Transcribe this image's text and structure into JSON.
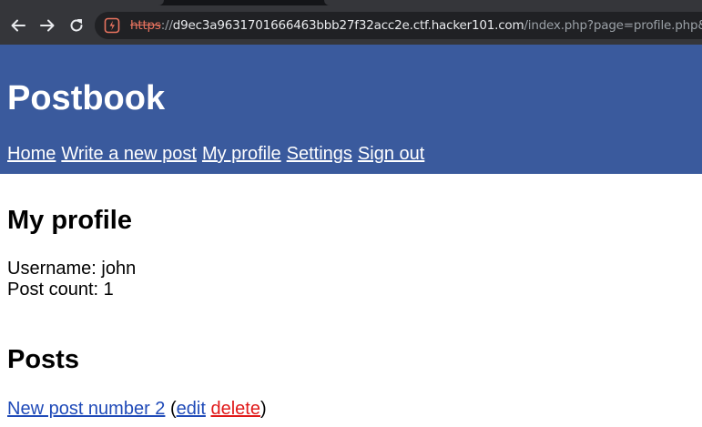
{
  "browser": {
    "url_scheme": "https",
    "url_separator": "://",
    "url_host": "d9ec3a9631701666463bbb27f32acc2e.ctf.hacker101.com",
    "url_path": "/index.php?page=profile.php&id=e"
  },
  "header": {
    "title": "Postbook",
    "nav": [
      "Home",
      "Write a new post",
      "My profile",
      "Settings",
      "Sign out"
    ]
  },
  "profile": {
    "heading": "My profile",
    "username_label": "Username:",
    "username": "john",
    "post_count_label": "Post count:",
    "post_count": "1"
  },
  "posts": {
    "heading": "Posts",
    "items": [
      {
        "title": "New post number 2",
        "open_paren": "(",
        "edit": "edit",
        "delete": "delete",
        "close_paren": ")"
      }
    ]
  },
  "colors": {
    "header_bg": "#3a5a9d",
    "link": "#1f4ab8",
    "delete_link": "#e01919"
  }
}
